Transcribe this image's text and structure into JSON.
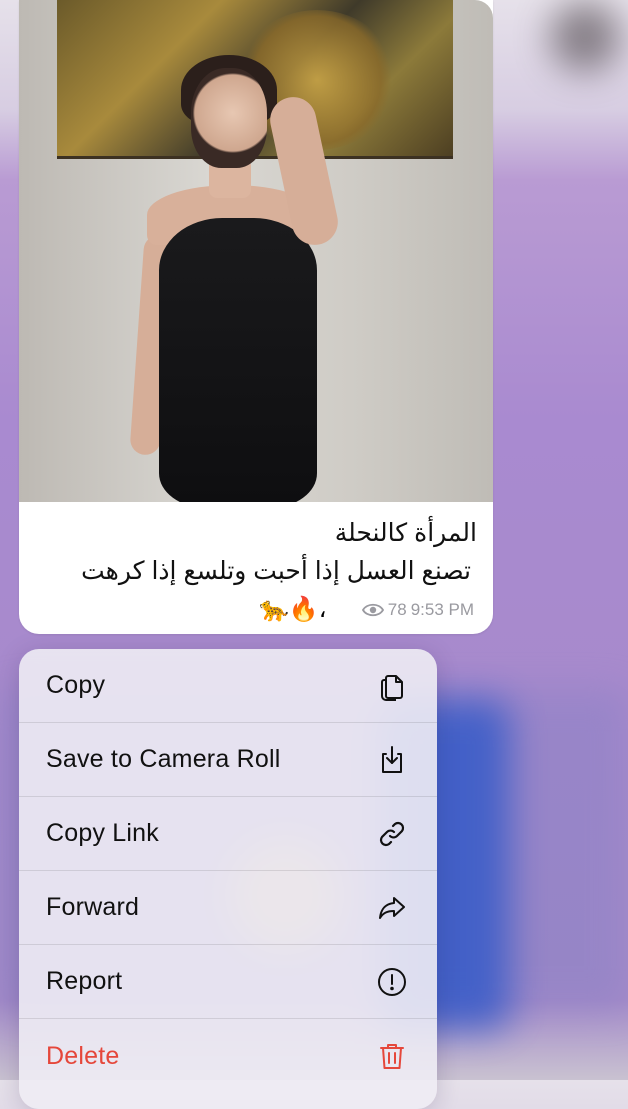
{
  "message": {
    "caption_line1": "المرأة كالنحلة",
    "caption_line2": "تصنع العسل إذا أحبت وتلسع إذا كرهت",
    "emojis": "🐆🔥،",
    "views": "78",
    "time": "9:53 PM"
  },
  "menu": {
    "items": [
      {
        "label": "Copy",
        "icon": "copy-icon"
      },
      {
        "label": "Save to Camera Roll",
        "icon": "download-icon"
      },
      {
        "label": "Copy Link",
        "icon": "link-icon"
      },
      {
        "label": "Forward",
        "icon": "forward-icon"
      },
      {
        "label": "Report",
        "icon": "alert-circle-icon"
      },
      {
        "label": "Delete",
        "icon": "trash-icon"
      }
    ],
    "danger_color": "#e5473b"
  }
}
